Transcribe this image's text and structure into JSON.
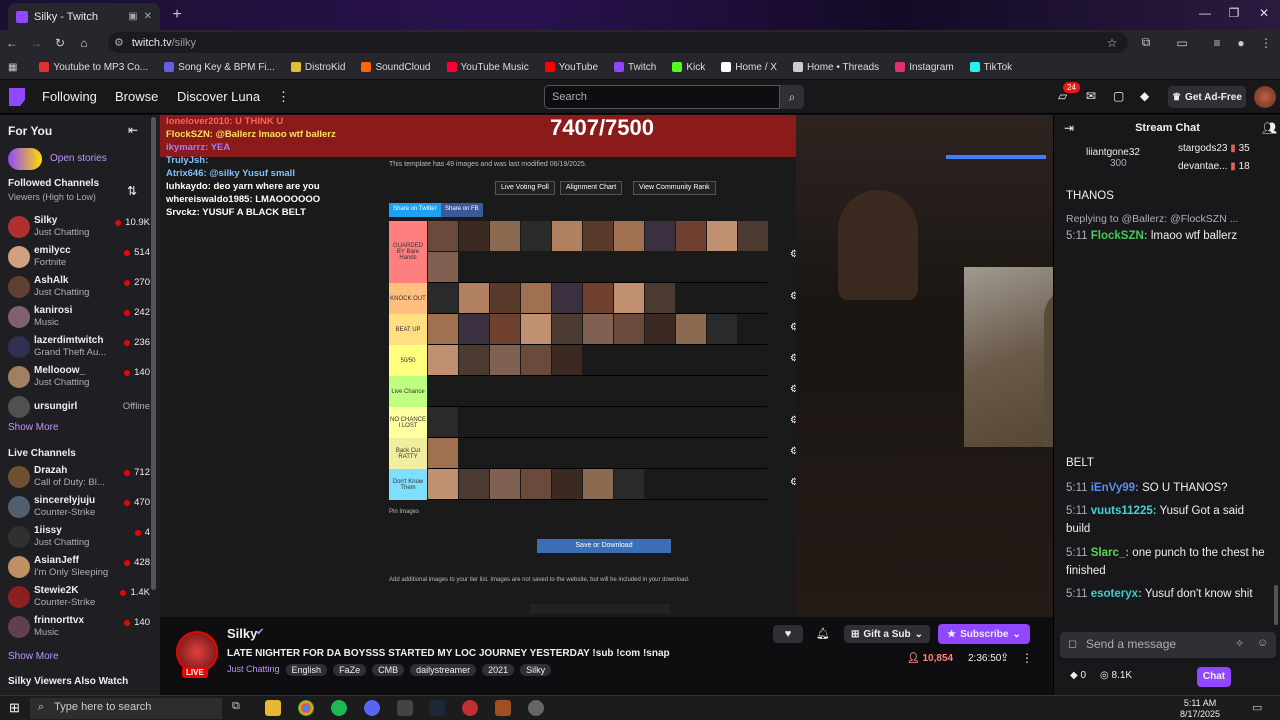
{
  "browser": {
    "tab_title": "Silky - Twitch",
    "url_host": "twitch.tv",
    "url_path": "/silky",
    "bookmarks": [
      {
        "label": "Youtube to MP3 Co...",
        "color": "#e03030"
      },
      {
        "label": "Song Key & BPM Fi...",
        "color": "#6060e0"
      },
      {
        "label": "DistroKid",
        "color": "#e0c030"
      },
      {
        "label": "SoundCloud",
        "color": "#ff6600"
      },
      {
        "label": "YouTube Music",
        "color": "#ff0033"
      },
      {
        "label": "YouTube",
        "color": "#ff0000"
      },
      {
        "label": "Twitch",
        "color": "#9147ff"
      },
      {
        "label": "Kick",
        "color": "#53fc18"
      },
      {
        "label": "Home / X",
        "color": "#ffffff"
      },
      {
        "label": "Home • Threads",
        "color": "#cccccc"
      },
      {
        "label": "Instagram",
        "color": "#e1306c"
      },
      {
        "label": "TikTok",
        "color": "#25f4ee"
      }
    ]
  },
  "nav": {
    "following": "Following",
    "browse": "Browse",
    "discover": "Discover Luna",
    "search_placeholder": "Search",
    "notif_count": "24",
    "ad_free": "Get Ad-Free"
  },
  "sidebar": {
    "for_you": "For You",
    "open_stories": "Open stories",
    "followed_title": "Followed Channels",
    "followed_sort": "Viewers (High to Low)",
    "followed": [
      {
        "name": "Silky",
        "game": "Just Chatting",
        "viewers": "10.9K",
        "color": "#b03030"
      },
      {
        "name": "emilycc",
        "game": "Fortnite",
        "viewers": "514",
        "color": "#d0a080"
      },
      {
        "name": "AshAlk",
        "game": "Just Chatting",
        "viewers": "270",
        "color": "#604030"
      },
      {
        "name": "kanirosi",
        "game": "Music",
        "viewers": "242",
        "color": "#806070"
      },
      {
        "name": "lazerdimtwitch",
        "game": "Grand Theft Au...",
        "viewers": "236",
        "color": "#303050"
      },
      {
        "name": "Mellooow_",
        "game": "Just Chatting",
        "viewers": "140",
        "color": "#a08060"
      },
      {
        "name": "ursungirl",
        "game": "",
        "viewers": "Offline",
        "color": "#505050"
      }
    ],
    "show_more": "Show More",
    "live_title": "Live Channels",
    "live": [
      {
        "name": "Drazah",
        "game": "Call of Duty: Bl...",
        "viewers": "712",
        "color": "#705030"
      },
      {
        "name": "sincerelyjuju",
        "game": "Counter-Strike",
        "viewers": "470",
        "color": "#506070"
      },
      {
        "name": "1iissy",
        "game": "Just Chatting",
        "viewers": "4",
        "color": "#303030"
      },
      {
        "name": "AsianJeff",
        "game": "I'm Only Sleeping",
        "viewers": "428",
        "color": "#c09060"
      },
      {
        "name": "Stewie2K",
        "game": "Counter-Strike",
        "viewers": "1.4K",
        "color": "#8a2020"
      },
      {
        "name": "frinnorttvx",
        "game": "Music",
        "viewers": "140",
        "color": "#604050"
      }
    ],
    "show_more_2": "Show More",
    "also_watch": "Silky Viewers Also Watch"
  },
  "video": {
    "counter": "7407/7500",
    "chat_overlay": [
      {
        "text": "lonelover2010: U THINK U",
        "color": "#ff6060"
      },
      {
        "text": "FlockSZN: @Ballerz lmaoo wtf ballerz",
        "color": "#ffe060"
      },
      {
        "text": "ikymarrz: YEA",
        "color": "#a080ff"
      },
      {
        "text": "TrulyJsh:",
        "color": "#80c0ff"
      },
      {
        "text": "Atrix646: @silky Yusuf small",
        "color": "#80c0ff"
      },
      {
        "text": "luhkaydo: deo yarn where are you",
        "color": "#ffffff"
      },
      {
        "text": "whereiswaldo1985: LMAOOOOOO",
        "color": "#ffffff"
      },
      {
        "text": "Srvckz: YUSUF A BLACK BELT",
        "color": "#ffffff"
      }
    ],
    "template_note": "This template has 49 images and was last modified 06/19/2025.",
    "buttons": [
      "Live Voting Poll",
      "Alignment Chart",
      "View Community Rank"
    ],
    "share_twitter": "Share on Twitter",
    "share_fb": "Share on FB",
    "tiers": [
      {
        "label": "GUARDED BY Bare Hands",
        "color": "#ff7f7f",
        "count": 12
      },
      {
        "label": "KNOCK OUT",
        "color": "#ffbf7f",
        "count": 8
      },
      {
        "label": "BEAT UP",
        "color": "#ffdf7f",
        "count": 10
      },
      {
        "label": "50/50",
        "color": "#ffff7f",
        "count": 5
      },
      {
        "label": "Live Chance",
        "color": "#bfff7f",
        "count": 0
      },
      {
        "label": "NO CHANCE I LOST",
        "color": "#ffff9f",
        "count": 1
      },
      {
        "label": "Back Cut RATTY",
        "color": "#efef9f",
        "count": 1
      },
      {
        "label": "Don't Know Them",
        "color": "#7fdfff",
        "count": 7
      }
    ],
    "pin_images": "Pin Images",
    "save": "Save or Download",
    "additional": "Add additional images to your tier list. Images are not saved to the website, but will be included in your download."
  },
  "stream": {
    "channel": "Silky",
    "live": "LIVE",
    "title": "LATE NIGHTER FOR DA BOYSSS STARTED MY LOC JOURNEY YESTERDAY !sub !com !snap",
    "category": "Just Chatting",
    "tags": [
      "English",
      "FaZe",
      "CMB",
      "dailystreamer",
      "2021",
      "Silky"
    ],
    "gift": "Gift a Sub",
    "subscribe": "Subscribe",
    "viewers": "10,854",
    "uptime": "2:36:50"
  },
  "chat": {
    "header": "Stream Chat",
    "gifters": [
      {
        "name": "liiantgone32",
        "count": "300"
      },
      {
        "name": "stargods23",
        "count": "35"
      },
      {
        "name": "devantae...",
        "count": "18"
      }
    ],
    "messages": [
      {
        "time": "",
        "user": "",
        "text": "THANOS",
        "color": "#efeff1"
      },
      {
        "time": "",
        "user": "",
        "text": "Replying to @Ballerz: @FlockSZN ...",
        "color": "#adadb8"
      },
      {
        "time": "5:11",
        "user": "FlockSZN:",
        "text": "lmaoo wtf ballerz",
        "color": "#4ac95a"
      },
      {
        "time": "",
        "user": "",
        "text": "BELT",
        "color": "#efeff1"
      },
      {
        "time": "5:11",
        "user": "iEnVy99:",
        "text": "SO U THANOS?",
        "color": "#5b8def"
      },
      {
        "time": "5:11",
        "user": "vuuts11225:",
        "text": "Yusuf Got a said build",
        "color": "#42d4d4"
      },
      {
        "time": "5:11",
        "user": "Slarc_:",
        "text": "one punch to the chest he finished",
        "color": "#57d657"
      },
      {
        "time": "5:11",
        "user": "esoteryx:",
        "text": "Yusuf don't know shit",
        "color": "#42c9c9"
      }
    ],
    "input_placeholder": "Send a message",
    "points": "0",
    "channel_points": "8.1K",
    "chat_btn": "Chat"
  },
  "taskbar": {
    "search": "Type here to search",
    "time": "5:11 AM",
    "date": "8/17/2025"
  }
}
